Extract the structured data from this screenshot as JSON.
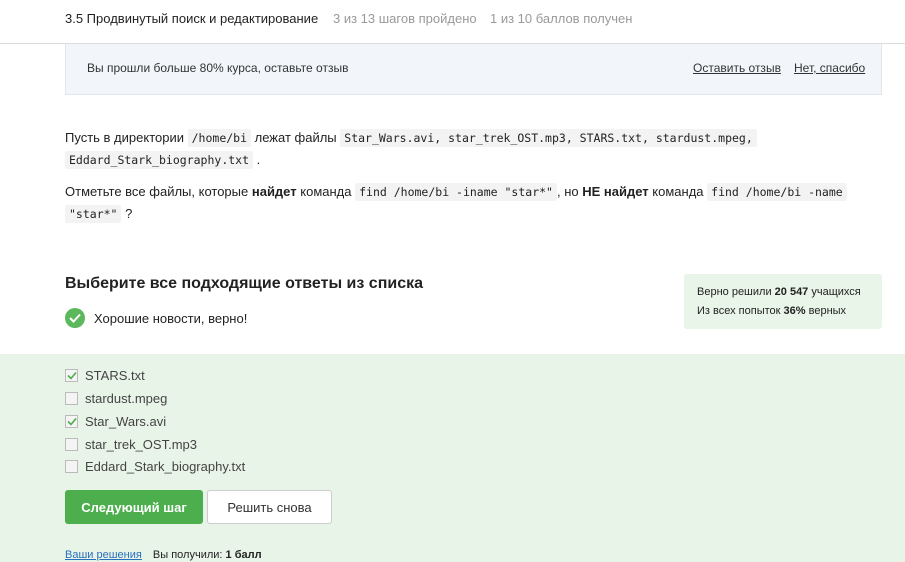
{
  "header": {
    "title": "3.5 Продвинутый поиск и редактирование",
    "steps": "3 из 13 шагов пройдено",
    "points": "1 из 10 баллов  получен"
  },
  "feedback": {
    "message": "Вы прошли больше 80% курса, оставьте отзыв",
    "leave_review": "Оставить отзыв",
    "no_thanks": "Нет, спасибо"
  },
  "question": {
    "p1_pre": "Пусть в директории",
    "p1_dir": "/home/bi",
    "p1_mid": "лежат файлы",
    "p1_files": "Star_Wars.avi, star_trek_OST.mp3, STARS.txt, stardust.mpeg,",
    "p1_files2": "Eddard_Stark_biography.txt",
    "p1_end": ".",
    "p2_pre": "Отметьте все файлы, которые",
    "p2_bold1": "найдет",
    "p2_cmd_word": "команда",
    "p2_cmd1": "find /home/bi -iname \"star*\"",
    "p2_but": ", но",
    "p2_bold2": "НЕ найдет",
    "p2_cmd_word2": "команда",
    "p2_cmd2a": "find /home/bi -name",
    "p2_cmd2b": "\"star*\"",
    "p2_end": "?"
  },
  "answer_section": {
    "title": "Выберите все подходящие ответы из списка",
    "good_news": "Хорошие новости, верно!"
  },
  "stats": {
    "solved_pre": "Верно решили",
    "solved_count": "20 547",
    "solved_post": "учащихся",
    "attempts_pre": "Из всех попыток",
    "attempts_pct": "36%",
    "attempts_post": "верных"
  },
  "options": [
    {
      "label": "STARS.txt",
      "checked": true
    },
    {
      "label": "stardust.mpeg",
      "checked": false
    },
    {
      "label": "Star_Wars.avi",
      "checked": true
    },
    {
      "label": "star_trek_OST.mp3",
      "checked": false
    },
    {
      "label": "Eddard_Stark_biography.txt",
      "checked": false
    }
  ],
  "buttons": {
    "next": "Следующий шаг",
    "retry": "Решить снова"
  },
  "footer": {
    "solutions_link": "Ваши решения",
    "got_pre": "Вы получили:",
    "got_value": "1 балл"
  },
  "colors": {
    "success_green": "#4cae4c",
    "answers_bg": "#e8f4e8",
    "link_blue": "#2a6fbd"
  }
}
